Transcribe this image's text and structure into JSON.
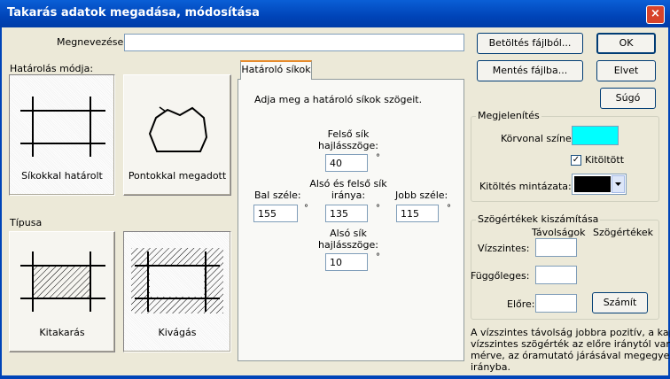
{
  "window": {
    "title": "Takarás adatok megadása, módosítása",
    "close_glyph": "×"
  },
  "name_field": {
    "label": "Megnevezése:",
    "value": ""
  },
  "buttons": {
    "load": "Betöltés fájlból...",
    "save": "Mentés fájlba...",
    "ok": "OK",
    "cancel": "Elvet",
    "help": "Súgó",
    "compute": "Számít"
  },
  "bounding_mode": {
    "label": "Határolás módja:",
    "planes": "Síkokkal határolt",
    "points": "Pontokkal megadott"
  },
  "type_section": {
    "label": "Típusa",
    "masking": "Kitakarás",
    "cutout": "Kivágás"
  },
  "tab": {
    "label": "Határoló síkok",
    "instruction": "Adja meg a határoló síkok szögeit."
  },
  "angles": {
    "top": {
      "label_line1": "Felső sík",
      "label_line2": "hajlásszöge:",
      "value": "40"
    },
    "left": {
      "label": "Bal széle:",
      "value": "155"
    },
    "middle": {
      "label_line1": "Alsó és felső sík",
      "label_line2": "iránya:",
      "value": "135"
    },
    "right": {
      "label": "Jobb széle:",
      "value": "115"
    },
    "bottom": {
      "label_line1": "Alsó sík",
      "label_line2": "hajlásszöge:",
      "value": "10"
    },
    "degree_symbol": "°"
  },
  "display": {
    "title": "Megjelenítés",
    "outline_color_label": "Körvonal színe:",
    "outline_color": "#00ffff",
    "filled_label": "Kitöltött",
    "filled_checked": true,
    "fill_pattern_label": "Kitöltés mintázata:",
    "fill_pattern_color": "#000000"
  },
  "angle_calc": {
    "title": "Szögértékek kiszámítása",
    "col_distances": "Távolságok",
    "col_angles": "Szögértékek",
    "horizontal_label": "Vízszintes:",
    "vertical_label": "Függőleges:",
    "forward_label": "Előre:",
    "horizontal_value": "",
    "vertical_value": "",
    "forward_value": ""
  },
  "note": {
    "line1": "A vízszintes távolság jobbra pozitív, a kapott",
    "line2": "vízszintes szögérték az előre iránytól van",
    "line3": "mérve, az óramutató járásával megegyező",
    "line4": "irányba."
  }
}
